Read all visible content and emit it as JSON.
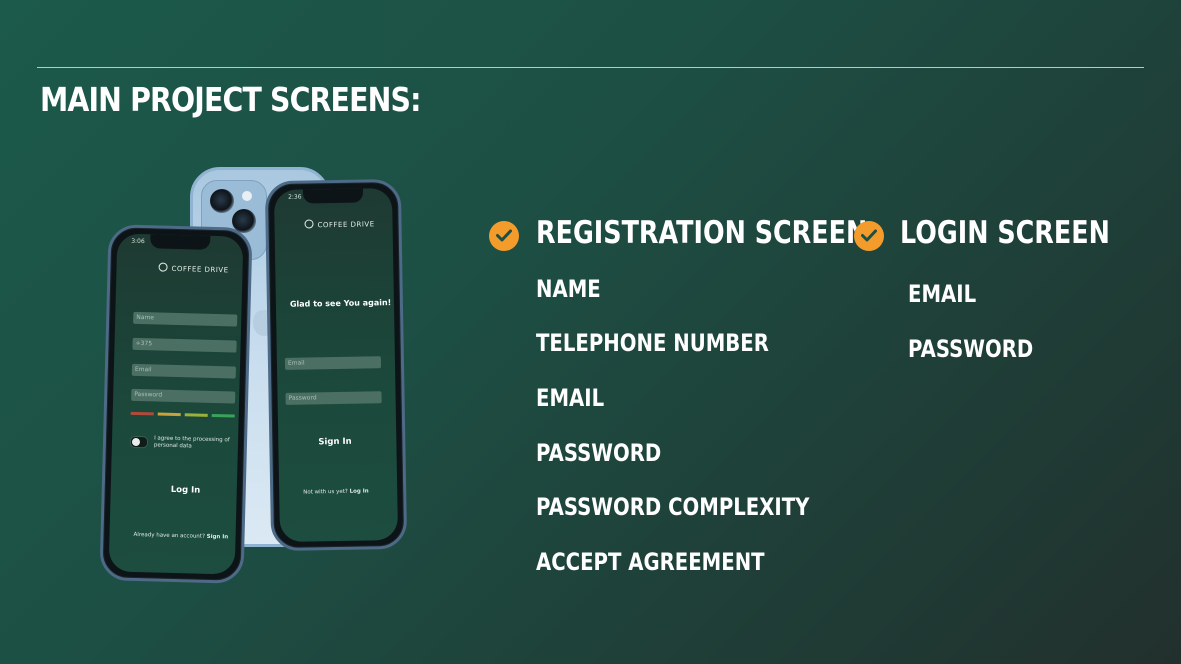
{
  "slide": {
    "title": "MAIN PROJECT SCREENS:"
  },
  "registration_phone": {
    "time": "3:06",
    "brand": "COFFEE DRIVE",
    "fields": [
      {
        "placeholder": "Name"
      },
      {
        "value": "+375"
      },
      {
        "placeholder": "Email"
      },
      {
        "placeholder": "Password"
      }
    ],
    "strength_colors": [
      "#b04a3a",
      "#c9a23a",
      "#9bb23a",
      "#3aa35a"
    ],
    "agreement_text": "I agree to the processing of personal data",
    "button": "Log In",
    "footer_question": "Already have an account?",
    "footer_link": "Sign In"
  },
  "login_phone": {
    "time": "2:36",
    "brand": "COFFEE DRIVE",
    "greeting": "Glad to see You again!",
    "fields": [
      {
        "placeholder": "Email"
      },
      {
        "placeholder": "Password"
      }
    ],
    "button": "Sign In",
    "footer_question": "Not with us yet?",
    "footer_link": "Log In"
  },
  "registration": {
    "title": "REGISTRATION SCREEN",
    "items": [
      "NAME",
      "TELEPHONE NUMBER",
      "EMAIL",
      "PASSWORD",
      "PASSWORD COMPLEXITY",
      "ACCEPT AGREEMENT"
    ]
  },
  "login": {
    "title": "LOGIN SCREEN",
    "items": [
      "EMAIL",
      "PASSWORD"
    ]
  },
  "colors": {
    "accent": "#f39c2b",
    "background": "#1d4f44"
  }
}
